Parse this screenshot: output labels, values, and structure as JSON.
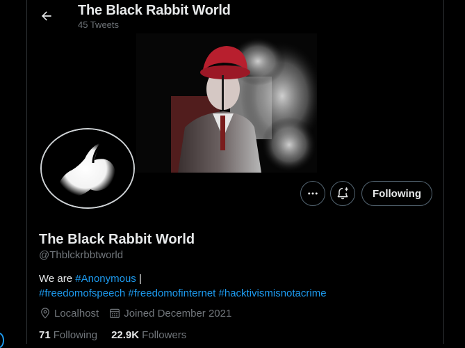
{
  "header": {
    "title": "The Black Rabbit World",
    "tweet_count": "45 Tweets",
    "back_icon": "arrow-left-icon"
  },
  "profile": {
    "display_name": "The Black Rabbit World",
    "handle": "@Thblckrbbtworld",
    "bio": {
      "text_prefix": "We are ",
      "hashtag_anonymous": "#Anonymous",
      "text_suffix": " |",
      "hashtag_speech": "#freedomofspeech",
      "hashtag_internet": "#freedomofinternet",
      "hashtag_hacktivism": "#hacktivismisnotacrime"
    },
    "location": "Localhost",
    "joined": "Joined December 2021",
    "following_count": "71",
    "following_label": "Following",
    "followers_count": "22.9K",
    "followers_label": "Followers"
  },
  "actions": {
    "more_icon": "more-horizontal-icon",
    "notify_icon": "bell-plus-icon",
    "following_button": "Following"
  },
  "colors": {
    "background": "#000000",
    "text_primary": "#e7e9ea",
    "text_secondary": "#71767b",
    "link": "#1d9bf0",
    "border": "#536471"
  }
}
